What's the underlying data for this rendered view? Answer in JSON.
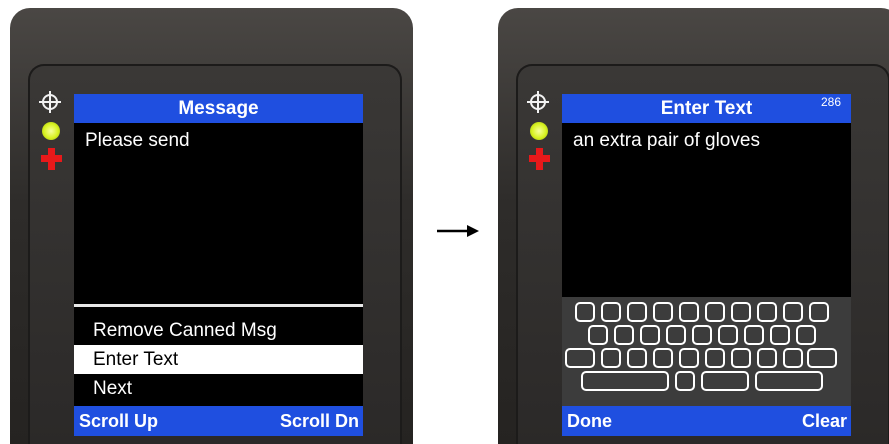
{
  "left_screen": {
    "title": "Message",
    "message_text": "Please send",
    "menu_items": [
      "Remove Canned Msg",
      "Enter Text",
      "Next"
    ],
    "selected_menu_item": "Enter Text",
    "softkey_left": "Scroll Up",
    "softkey_right": "Scroll Dn"
  },
  "right_screen": {
    "title": "Enter Text",
    "char_counter": "286",
    "entered_text": "an extra pair of gloves",
    "softkey_left": "Done",
    "softkey_right": "Clear"
  },
  "colors": {
    "title_bar": "#1f4fe0",
    "screen_background": "#000000",
    "selection_highlight": "#ffffff",
    "status_led": "#d8f221",
    "alert_cross": "#e8191a"
  },
  "icons": [
    "crosshair-icon",
    "status-led-icon",
    "red-cross-icon",
    "arrow-right-icon"
  ]
}
